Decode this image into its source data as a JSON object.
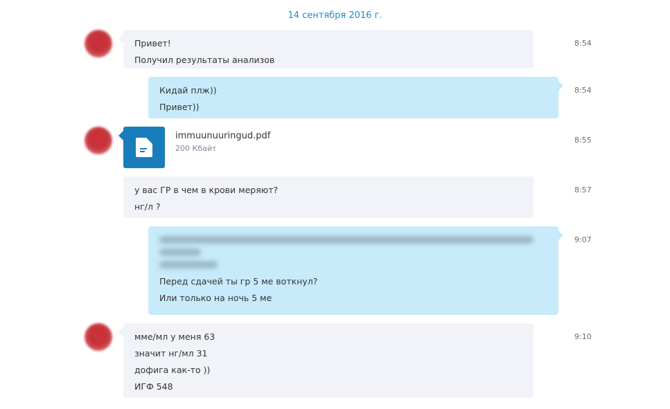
{
  "date": "14 сентября 2016 г.",
  "messages": [
    {
      "lines": [
        "Привет!",
        "Получил результаты анализов"
      ],
      "time": "8:54"
    },
    {
      "lines": [
        "Кидай плж))",
        "Привет))"
      ],
      "time": "8:54"
    },
    {
      "file": {
        "name": "immuunuuringud.pdf",
        "size": "200 Кбайт",
        "icon": "document-icon"
      },
      "time": "8:55"
    },
    {
      "lines": [
        "у вас ГР в чем в крови меряют?",
        "нг/л ?"
      ],
      "time": "8:57"
    },
    {
      "lines": [
        "Перед сдачей ты гр 5 ме воткнул?",
        "Или только на ночь 5 ме"
      ],
      "time": "9:07"
    },
    {
      "lines": [
        "мме/мл у меня 63",
        "значит нг/мл 31",
        "дофига как-то ))",
        "ИГФ 548"
      ],
      "time": "9:10"
    }
  ],
  "colors": {
    "accent": "#1a8ecd",
    "incoming_bubble": "#f1f3f8",
    "outgoing_bubble": "#c7ebfb",
    "file_icon": "#1a7dbb"
  }
}
